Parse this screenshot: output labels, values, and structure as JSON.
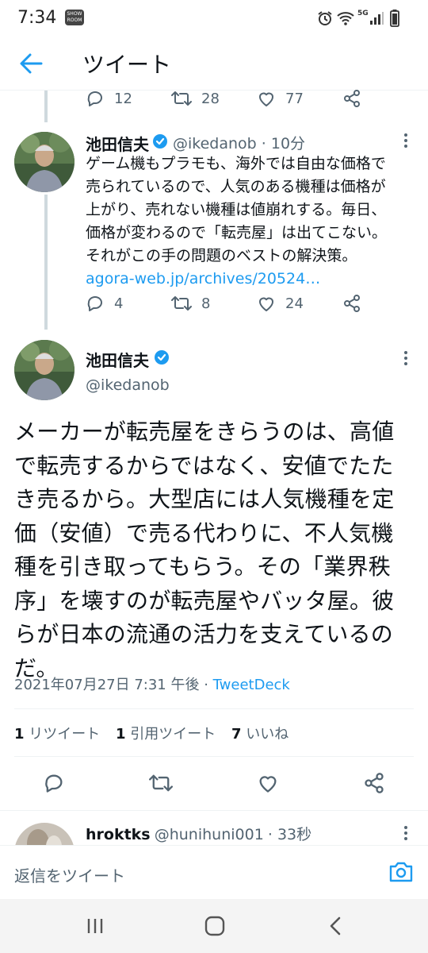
{
  "status_bar": {
    "time": "7:34",
    "showroom_badge": "SHOW ROOM",
    "network": "5G"
  },
  "header": {
    "title": "ツイート"
  },
  "prev_tweet_actions": {
    "replies": "12",
    "retweets": "28",
    "likes": "77"
  },
  "reply_tweet": {
    "name": "池田信夫",
    "handle": "@ikedanob",
    "time": "· 10分",
    "lines": [
      "ゲーム機もプラモも、海外では自由な価格で",
      "売られているので、人気のある機種は価格が",
      "上がり、売れない機種は値崩れする。毎日、",
      "価格が変わるので「転売屋」は出てこない。",
      "それがこの手の問題のベストの解決策。"
    ],
    "link": "agora-web.jp/archives/20524…",
    "replies": "4",
    "retweets": "8",
    "likes": "24"
  },
  "main_tweet": {
    "name": "池田信夫",
    "handle": "@ikedanob",
    "lines": [
      "メーカーが転売屋をきらうのは、高値",
      "で転売するからではなく、安値でたた",
      "き売るから。大型店には人気機種を定",
      "価（安値）で売る代わりに、不人気機",
      "種を引き取ってもらう。その「業界秩",
      "序」を壊すのが転売屋やバッタ屋。彼",
      "らが日本の流通の活力を支えているの",
      "だ。"
    ],
    "timestamp": "2021年07月27日 7:31 午後 · ",
    "source": "TweetDeck",
    "stats": {
      "retweets_count": "1",
      "retweets_label": "リツイート",
      "quotes_count": "1",
      "quotes_label": "引用ツイート",
      "likes_count": "7",
      "likes_label": "いいね"
    }
  },
  "next_reply": {
    "name": "hroktks",
    "handle": "@hunihuni001",
    "time": "· 33秒"
  },
  "reply_bar": {
    "placeholder": "返信をツイート"
  },
  "colors": {
    "accent": "#1d9bf0",
    "text": "#0f1419",
    "muted": "#536471",
    "verified": "#1d9bf0"
  }
}
